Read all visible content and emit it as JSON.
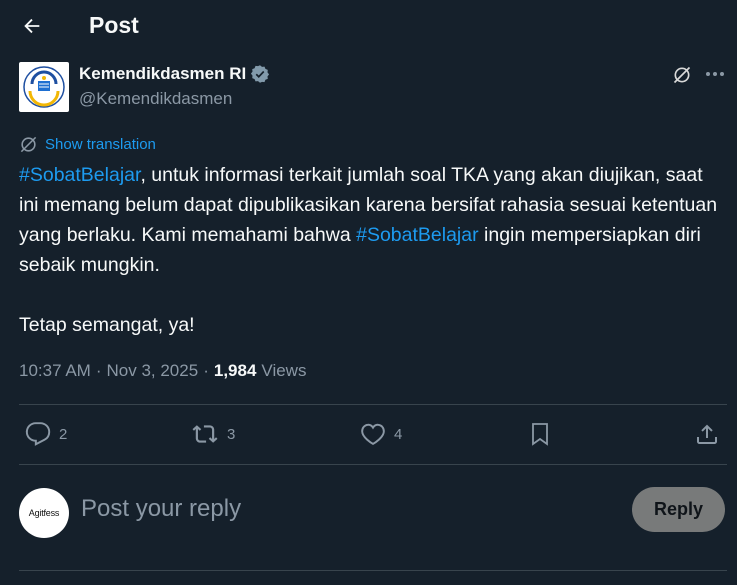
{
  "header": {
    "title": "Post"
  },
  "author": {
    "name": "Kemendikdasmen RI",
    "handle": "@Kemendikdasmen"
  },
  "translation": {
    "label": "Show translation"
  },
  "tweet": {
    "segments": [
      {
        "tag": "#SobatBelajar",
        "text": ", untuk informasi terkait jumlah soal TKA yang akan diujikan, saat ini memang belum dapat dipublikasikan karena bersifat rahasia sesuai ketentuan yang berlaku. Kami memahami bahwa "
      },
      {
        "tag": "#SobatBelajar",
        "text": " ingin mempersiapkan diri sebaik mungkin."
      }
    ],
    "closing": "Tetap semangat, ya!"
  },
  "meta": {
    "time": "10:37 AM",
    "sep1": "·",
    "date": "Nov 3, 2025",
    "sep2": "·",
    "views_count": "1,984",
    "views_label": "Views"
  },
  "actions": {
    "replies": "2",
    "reposts": "3",
    "likes": "4"
  },
  "reply_box": {
    "avatar_text": "Agitfess",
    "placeholder": "Post your reply",
    "button_label": "Reply"
  },
  "colors": {
    "accent": "#1d9bf0",
    "background": "#15202b",
    "muted": "#8b98a5",
    "verified": "#829aab"
  }
}
